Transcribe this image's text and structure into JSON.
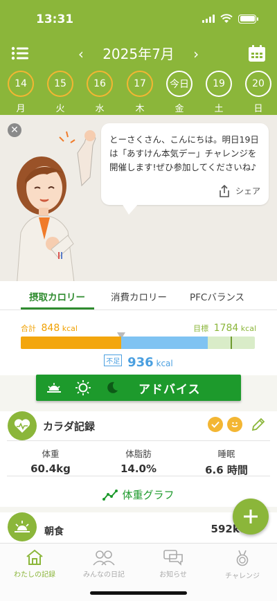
{
  "status": {
    "time": "13:31"
  },
  "nav": {
    "month_label": "2025年7月",
    "prev": "‹",
    "next": "›"
  },
  "days": [
    {
      "num": "14",
      "wd": "月",
      "state": "past"
    },
    {
      "num": "15",
      "wd": "火",
      "state": "past"
    },
    {
      "num": "16",
      "wd": "水",
      "state": "past"
    },
    {
      "num": "17",
      "wd": "木",
      "state": "past"
    },
    {
      "num": "今日",
      "wd": "金",
      "state": "today"
    },
    {
      "num": "19",
      "wd": "土",
      "state": "future"
    },
    {
      "num": "20",
      "wd": "日",
      "state": "future"
    }
  ],
  "message": {
    "text": "とーさくさん、こんにちは。明日19日は「あすけん本気デー」チャレンジを開催します!ぜひ参加してくださいね♪",
    "share_label": "シェア"
  },
  "calorie": {
    "tabs": [
      "摂取カロリー",
      "消費カロリー",
      "PFCバランス"
    ],
    "total_label": "合計",
    "total_value": "848",
    "goal_label": "目標",
    "goal_value": "1784",
    "unit": "kcal",
    "shortage_tag": "不足",
    "shortage_value": "936",
    "shortage_unit": "kcal",
    "intake_fraction": 0.43,
    "goal_fraction": 0.8,
    "colors": {
      "intake": "#f3a60d",
      "remaining": "#7fc3f2",
      "surplus_zone": "#d9ecc8"
    }
  },
  "advice": {
    "label": "アドバイス"
  },
  "body_record": {
    "title": "カラダ記録",
    "stats": [
      {
        "key": "体重",
        "value": "60.4kg"
      },
      {
        "key": "体脂肪",
        "value": "14.0%"
      },
      {
        "key": "睡眠",
        "value": "6.6 時間"
      }
    ],
    "graph_link": "体重グラフ"
  },
  "meal": {
    "title": "朝食",
    "kcal": "592kcal"
  },
  "tabbar": [
    {
      "label": "わたしの記録",
      "icon": "home-icon",
      "active": true
    },
    {
      "label": "みんなの日記",
      "icon": "people-icon",
      "active": false
    },
    {
      "label": "お知らせ",
      "icon": "chat-icon",
      "active": false
    },
    {
      "label": "チャレンジ",
      "icon": "medal-icon",
      "active": false
    }
  ],
  "theme": {
    "brand_green": "#8bb63a",
    "accent_orange": "#f3b633",
    "button_green": "#1d9a2c"
  }
}
